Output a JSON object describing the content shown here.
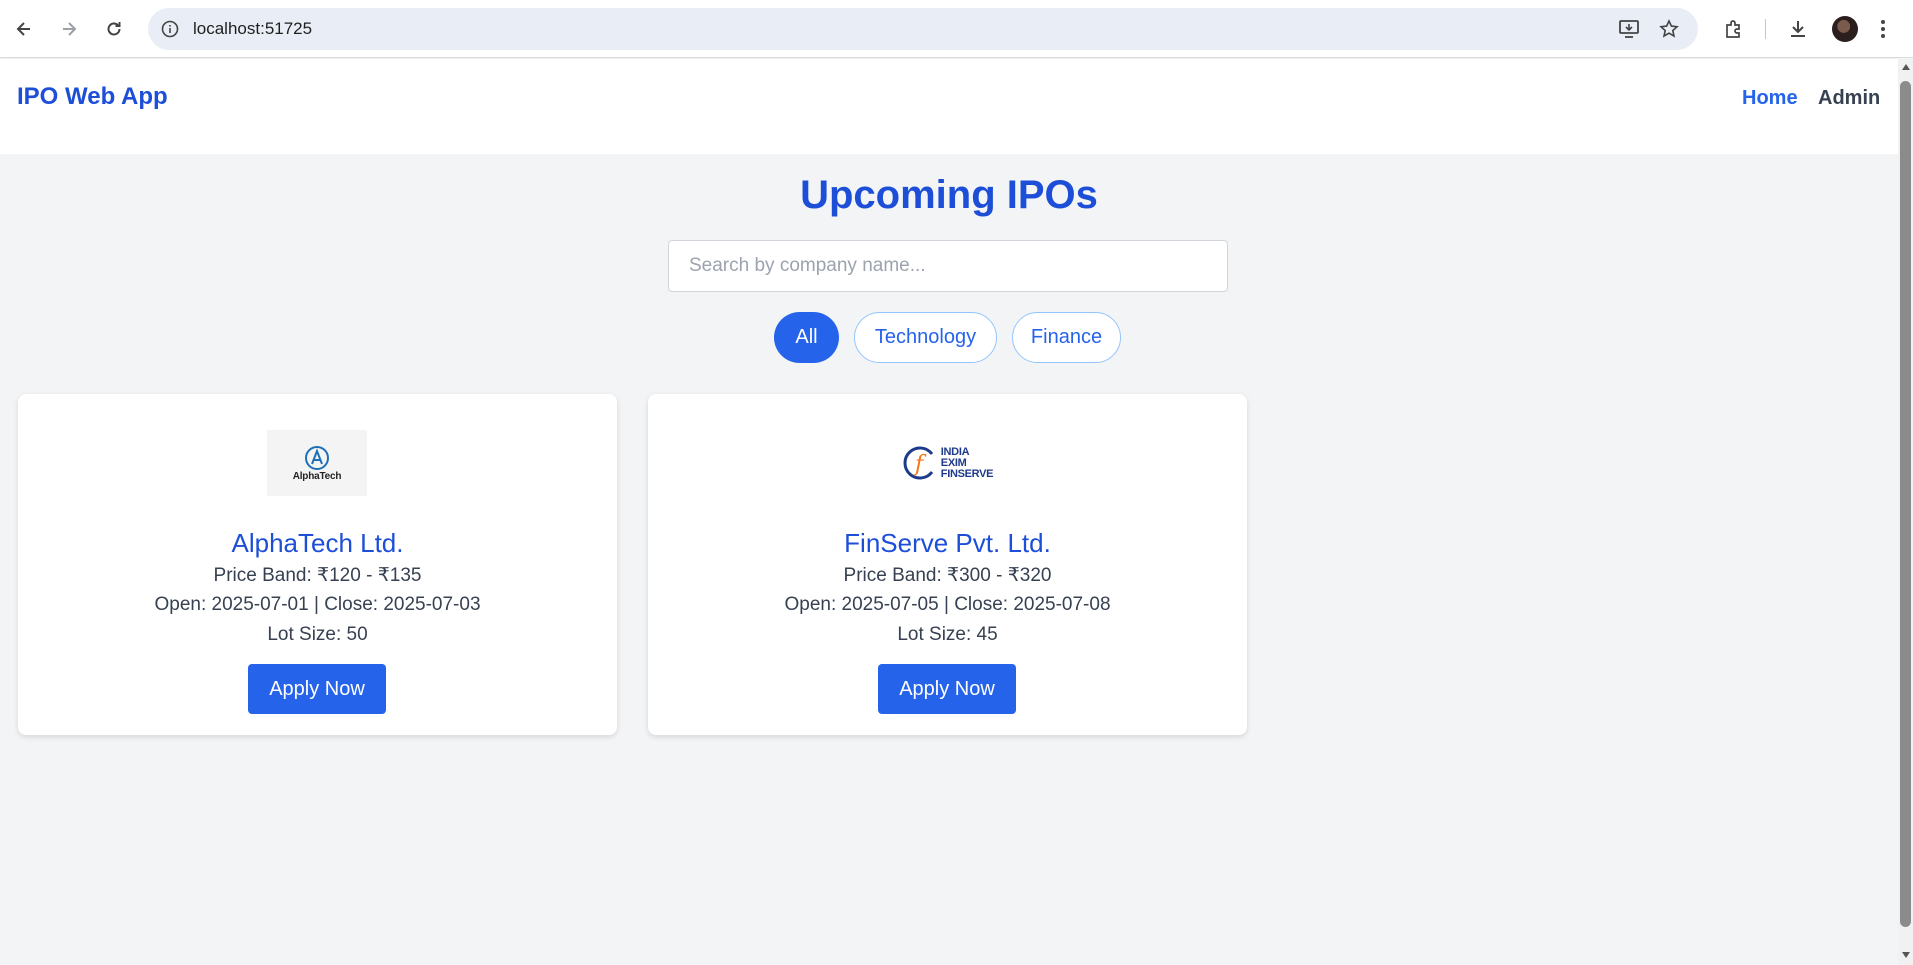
{
  "browser": {
    "url": "localhost:51725"
  },
  "navbar": {
    "brand": "IPO Web App",
    "links": [
      {
        "label": "Home",
        "active": true
      },
      {
        "label": "Admin",
        "active": false
      }
    ]
  },
  "main": {
    "title": "Upcoming IPOs",
    "search": {
      "placeholder": "Search by company name...",
      "value": ""
    },
    "filters": [
      {
        "label": "All",
        "selected": true
      },
      {
        "label": "Technology",
        "selected": false
      },
      {
        "label": "Finance",
        "selected": false
      }
    ],
    "cards": [
      {
        "logo_text": "AlphaTech",
        "name": "AlphaTech Ltd.",
        "price_band": "Price Band: ₹120 - ₹135",
        "dates": "Open: 2025-07-01 | Close: 2025-07-03",
        "lot_size": "Lot Size: 50",
        "button": "Apply Now"
      },
      {
        "logo_lines": [
          "INDIA",
          "EXIM",
          "FINSERVE"
        ],
        "name": "FinServe Pvt. Ltd.",
        "price_band": "Price Band: ₹300 - ₹320",
        "dates": "Open: 2025-07-05 | Close: 2025-07-08",
        "lot_size": "Lot Size: 45",
        "button": "Apply Now"
      }
    ]
  },
  "colors": {
    "primary": "#2563eb",
    "title": "#1d4ed8",
    "background": "#f3f4f6"
  }
}
